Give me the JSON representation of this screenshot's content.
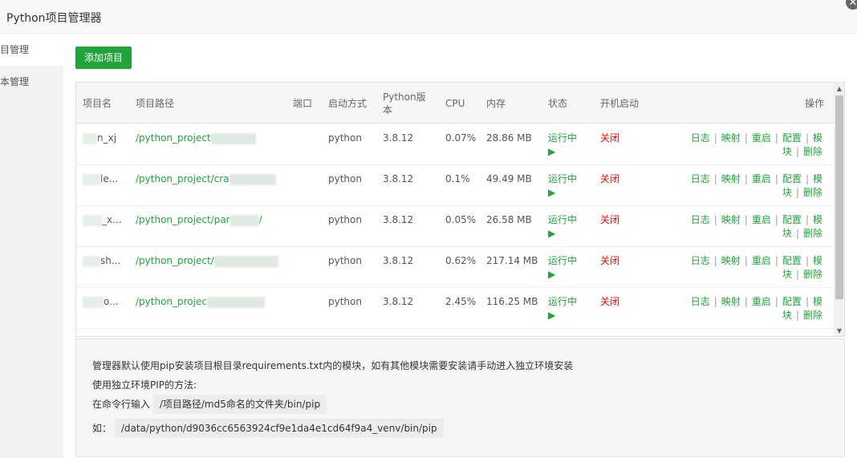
{
  "window": {
    "title": "Python项目管理器",
    "close_glyph": "✕"
  },
  "sidebar": {
    "items": [
      {
        "label": "项目管理"
      },
      {
        "label": "版本管理"
      }
    ]
  },
  "toolbar": {
    "add_label": "添加项目"
  },
  "table": {
    "headers": {
      "name": "项目名",
      "path": "项目路径",
      "port": "端口",
      "start": "启动方式",
      "python": "Python版本",
      "cpu": "CPU",
      "mem": "内存",
      "status": "状态",
      "boot": "开机启动",
      "ops": "操作"
    },
    "rows": [
      {
        "name": "n_xj",
        "path": "/python_project",
        "port": "",
        "start": "python",
        "python": "3.8.12",
        "cpu": "0.07%",
        "mem": "28.86 MB",
        "status": "运行中",
        "boot": "关闭"
      },
      {
        "name": "le...",
        "path": "/python_project/cra",
        "port": "",
        "start": "python",
        "python": "3.8.12",
        "cpu": "0.1%",
        "mem": "49.49 MB",
        "status": "运行中",
        "boot": "关闭"
      },
      {
        "name": "_x...",
        "path": "/python_project/par",
        "path_tail": "/",
        "port": "",
        "start": "python",
        "python": "3.8.12",
        "cpu": "0.05%",
        "mem": "26.58 MB",
        "status": "运行中",
        "boot": "关闭"
      },
      {
        "name": "sh...",
        "path": "/python_project/",
        "port": "",
        "start": "python",
        "python": "3.8.12",
        "cpu": "0.62%",
        "mem": "217.14 MB",
        "status": "运行中",
        "boot": "关闭"
      },
      {
        "name": "o...",
        "path": "/python_projec",
        "port": "",
        "start": "python",
        "python": "3.8.12",
        "cpu": "2.45%",
        "mem": "116.25 MB",
        "status": "运行中",
        "boot": "关闭"
      }
    ],
    "status_glyph": "▶",
    "ops": {
      "log": "日志",
      "map": "映射",
      "restart": "重启",
      "config": "配置",
      "module_a": "模",
      "module_b": "块",
      "delete": "删除",
      "sep": "|"
    }
  },
  "note": {
    "line1": "管理器默认使用pip安装项目根目录requirements.txt内的模块，如有其他模块需要安装请手动进入独立环境安装",
    "line2": "使用独立环境PIP的方法:",
    "line3_prefix": "在命令行输入",
    "line3_code": "/项目路径/md5命名的文件夹/bin/pip",
    "line4_prefix": "如：",
    "line4_code": "/data/python/d9036cc6563924cf9e1da4e1cd64f9a4_venv/bin/pip"
  },
  "colors": {
    "accent": "#20a53a",
    "danger": "#ef0808"
  }
}
